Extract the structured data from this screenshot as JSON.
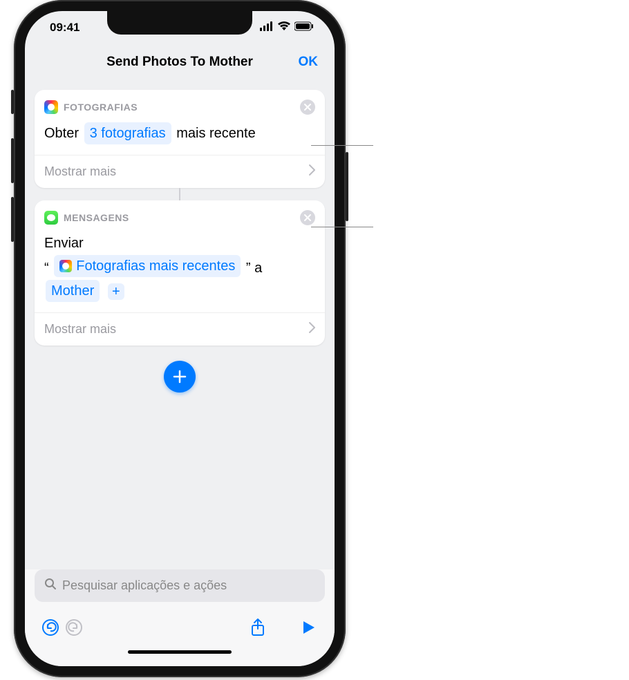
{
  "status": {
    "time": "09:41"
  },
  "nav": {
    "title": "Send Photos To Mother",
    "ok": "OK"
  },
  "actions": [
    {
      "app": "FOTOGRAFIAS",
      "text_prefix": "Obter",
      "token": "3 fotografias",
      "text_suffix": "mais recente",
      "show_more": "Mostrar mais"
    },
    {
      "app": "MENSAGENS",
      "text_prefix": "Enviar",
      "quote_open": "“",
      "token_content": "Fotografias mais recentes",
      "quote_close": "”",
      "text_conn": "a",
      "token_recipient": "Mother",
      "show_more": "Mostrar mais"
    }
  ],
  "search": {
    "placeholder": "Pesquisar aplicações e ações"
  }
}
